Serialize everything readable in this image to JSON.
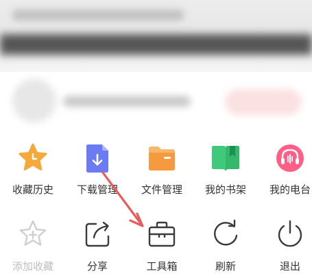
{
  "colors": {
    "star": "#f6a93b",
    "download_doc": "#6b7bf2",
    "folder": "#f59a3e",
    "bookshelf": "#3fc97a",
    "radio": "#ff5f86",
    "outline_icon": "#3a3a3a",
    "disabled": "#bdbdbd",
    "arrow": "#ec5b5b"
  },
  "menu": {
    "row1": [
      {
        "label": "收藏历史",
        "icon": "star-icon"
      },
      {
        "label": "下载管理",
        "icon": "download-icon"
      },
      {
        "label": "文件管理",
        "icon": "folder-icon"
      },
      {
        "label": "我的书架",
        "icon": "bookshelf-icon"
      },
      {
        "label": "我的电台",
        "icon": "radio-icon"
      }
    ],
    "row2": [
      {
        "label": "添加收藏",
        "icon": "add-bookmark-icon",
        "state": "disabled"
      },
      {
        "label": "分享",
        "icon": "share-icon"
      },
      {
        "label": "工具箱",
        "icon": "toolbox-icon"
      },
      {
        "label": "刷新",
        "icon": "refresh-icon"
      },
      {
        "label": "退出",
        "icon": "exit-icon"
      }
    ]
  }
}
